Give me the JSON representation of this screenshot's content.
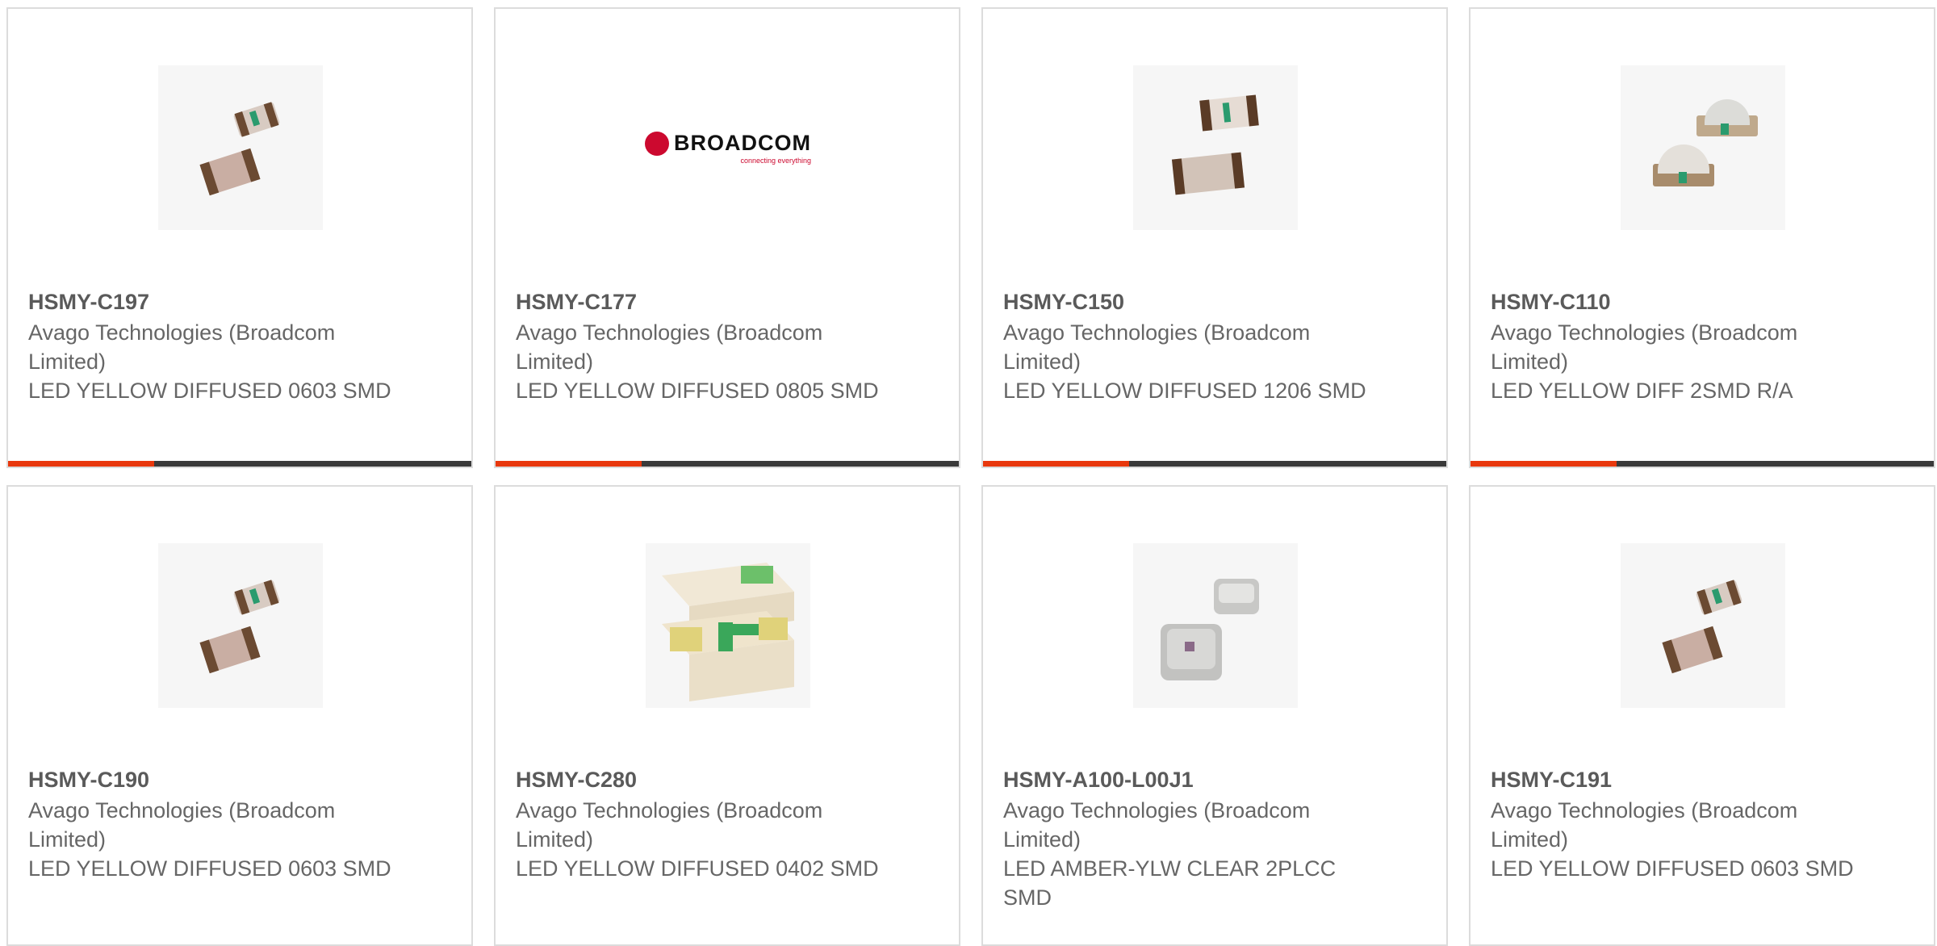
{
  "products": [
    {
      "part": "HSMY-C197",
      "manufacturer": "Avago Technologies (Broadcom Limited)",
      "description": "LED YELLOW DIFFUSED 0603 SMD",
      "image": "led-smd-pair-icon"
    },
    {
      "part": "HSMY-C177",
      "manufacturer": "Avago Technologies (Broadcom Limited)",
      "description": "LED YELLOW DIFFUSED 0805 SMD",
      "image": "broadcom-logo"
    },
    {
      "part": "HSMY-C150",
      "manufacturer": "Avago Technologies (Broadcom Limited)",
      "description": "LED YELLOW DIFFUSED 1206 SMD",
      "image": "led-smd-pair-icon"
    },
    {
      "part": "HSMY-C110",
      "manufacturer": "Avago Technologies (Broadcom Limited)",
      "description": "LED YELLOW DIFF 2SMD R/A",
      "image": "led-right-angle-icon"
    },
    {
      "part": "HSMY-C190",
      "manufacturer": "Avago Technologies (Broadcom Limited)",
      "description": "LED YELLOW DIFFUSED 0603 SMD",
      "image": "led-smd-pair-icon"
    },
    {
      "part": "HSMY-C280",
      "manufacturer": "Avago Technologies (Broadcom Limited)",
      "description": "LED YELLOW DIFFUSED 0402 SMD",
      "image": "led-chip-closeup-icon"
    },
    {
      "part": "HSMY-A100-L00J1",
      "manufacturer": "Avago Technologies (Broadcom Limited)",
      "description": "LED AMBER-YLW CLEAR 2PLCC SMD",
      "image": "led-plcc-icon"
    },
    {
      "part": "HSMY-C191",
      "manufacturer": "Avago Technologies (Broadcom Limited)",
      "description": "LED YELLOW DIFFUSED 0603 SMD",
      "image": "led-smd-pair-icon"
    }
  ],
  "broadcom_logo": {
    "wordmark": "BROADCOM",
    "tagline": "connecting everything"
  },
  "colors": {
    "accent": "#e8380d",
    "bar": "#3a3a3a",
    "border": "#dcdcdc",
    "text": "#666666"
  }
}
